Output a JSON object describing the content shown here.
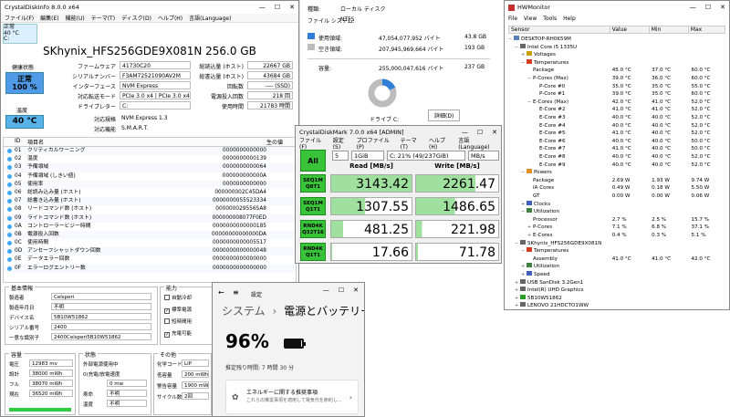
{
  "cdi": {
    "title": "CrystalDiskInfo 8.0.0 x64",
    "menu": [
      "ファイル(F)",
      "編集(E)",
      "機能(U)",
      "テーマ(T)",
      "ディスク(D)",
      "ヘルプ(H)",
      "言語(Language)"
    ],
    "mini_status": "正常",
    "mini_temp": "40 °C",
    "mini_drive": "C:",
    "disk_title": "SKhynix_HFS256GDE9X081N 256.0 GB",
    "health_label": "健康状態",
    "health_status": "正常",
    "health_pct": "100 %",
    "temp_label": "温度",
    "temp": "40 °C",
    "info": [
      {
        "l": "ファームウェア",
        "v": "41730C20"
      },
      {
        "l": "シリアルナンバー",
        "v": "F3AM72521090AV2M"
      },
      {
        "l": "インターフェース",
        "v": "NVM Express"
      },
      {
        "l": "対応転送モード",
        "v": "PCIe 3.0 x4 | PCIe 3.0 x4"
      },
      {
        "l": "ドライブレター",
        "v": "C:"
      }
    ],
    "info_r": [
      {
        "l": "総読込量 (ホスト)",
        "v": "22667 GB"
      },
      {
        "l": "総書込量 (ホスト)",
        "v": "43684 GB"
      },
      {
        "l": "回転数",
        "v": "---- (SSD)"
      },
      {
        "l": "電源投入回数",
        "v": "218 回"
      },
      {
        "l": "使用時間",
        "v": "21783 時間"
      }
    ],
    "std_l": "対応規格",
    "std_v": "NVM Express 1.3",
    "feat_l": "対応機能",
    "feat_v": "S.M.A.R.T.",
    "smart_hd": {
      "id": "ID",
      "name": "項目名",
      "raw": "生の値"
    },
    "smart": [
      {
        "id": "01",
        "n": "クリティカルワーニング",
        "r": "0000000000000"
      },
      {
        "id": "02",
        "n": "温度",
        "r": "0000000000139"
      },
      {
        "id": "03",
        "n": "予備領域",
        "r": "0000000000064"
      },
      {
        "id": "04",
        "n": "予備領域 (しきい値)",
        "r": "000000000000A"
      },
      {
        "id": "05",
        "n": "使用率",
        "r": "0000000000000"
      },
      {
        "id": "06",
        "n": "総読み込み量 (ホスト)",
        "r": "000000002C45DA4"
      },
      {
        "id": "07",
        "n": "総書き込み量 (ホスト)",
        "r": "0000000055523334"
      },
      {
        "id": "08",
        "n": "リードコマンド数 (ホスト)",
        "r": "000000029556SA8"
      },
      {
        "id": "09",
        "n": "ライトコマンド数 (ホスト)",
        "r": "000000008077F0ED"
      },
      {
        "id": "0A",
        "n": "コントローラービジー時間",
        "r": "0000000000000185"
      },
      {
        "id": "0B",
        "n": "電源投入回数",
        "r": "00000000000000DA"
      },
      {
        "id": "0C",
        "n": "使用時間",
        "r": "0000000000005517"
      },
      {
        "id": "0D",
        "n": "アンセーフシャットダウン回数",
        "r": "0000000000000048"
      },
      {
        "id": "0E",
        "n": "データエラー回数",
        "r": "0000000000000000"
      },
      {
        "id": "0F",
        "n": "エラーログエントリー数",
        "r": "0000000000000000"
      }
    ],
    "basic": {
      "title": "基本情報",
      "rows": [
        {
          "l": "製造者",
          "v": "Celsperi"
        },
        {
          "l": "製造年月日",
          "v": "不明"
        },
        {
          "l": "デバイス名",
          "v": "5B10W51862"
        },
        {
          "l": "シリアル番号",
          "v": "2400"
        },
        {
          "l": "一意な識別子",
          "v": "2400Celsperi5B10W51862"
        }
      ]
    },
    "ability": {
      "title": "能力",
      "items": [
        {
          "l": "自動冷却",
          "c": false
        },
        {
          "l": "標準電源",
          "c": true
        },
        {
          "l": "短時間用",
          "c": false
        },
        {
          "l": "充電可能",
          "c": true
        }
      ]
    },
    "cap": {
      "title": "容量",
      "rows": [
        {
          "l": "電圧",
          "v": "12983 mv"
        },
        {
          "l": "設計",
          "v": "38000 mWh"
        },
        {
          "l": "フル",
          "v": "38070 mWh"
        },
        {
          "l": "現在",
          "v": "36520 mWh"
        }
      ]
    },
    "state": {
      "title": "状態",
      "rows": [
        {
          "l": "外部電源使用中",
          "v": ""
        },
        {
          "l": "0(充電/放電速度",
          "v": ""
        },
        {
          "l": "",
          "v": "0 mw"
        },
        {
          "l": "寿命",
          "v": "不明"
        },
        {
          "l": "温度",
          "v": "不明"
        }
      ]
    },
    "other": {
      "title": "その他",
      "rows": [
        {
          "l": "化学コード",
          "v": "LiP"
        },
        {
          "l": "低容量",
          "v": "200 mWh"
        },
        {
          "l": "警告容量",
          "v": "1900 mWh"
        },
        {
          "l": "サイクル数",
          "v": "2回"
        }
      ]
    }
  },
  "fp": {
    "type_l": "種類:",
    "type_v": "ローカル ディスク",
    "fs_l": "ファイル システム:",
    "fs_v": "NTFS",
    "used_l": "使用領域:",
    "used_b": "47,054,077,952 バイト",
    "used_g": "43.8 GB",
    "free_l": "空き領域:",
    "free_b": "207,945,969,664 バイト",
    "free_g": "193 GB",
    "cap_l": "容量:",
    "cap_b": "255,000,047,616 バイト",
    "cap_g": "237 GB",
    "drive": "ドライブ C:",
    "detail": "詳細(D)",
    "used_color": "#2f7fd8",
    "free_color": "#bcbcbc"
  },
  "cdm": {
    "title": "CrystalDiskMark 7.0.0 x64 [ADMIN]",
    "menu": [
      "ファイル(F)",
      "設定(S)",
      "プロファイル(P)",
      "テーマ(T)",
      "ヘルプ(H)",
      "言語(Language)"
    ],
    "count": "5",
    "size": "1GiB",
    "drive": "C: 21% (49/237GiB)",
    "unit": "MB/s",
    "all": "All",
    "read_hd": "Read [MB/s]",
    "write_hd": "Write [MB/s]",
    "rows": [
      {
        "b1": "SEQ1M",
        "b2": "Q8T1",
        "r": "3143.42",
        "w": "2261.47",
        "rf": 1.0,
        "wf": 0.72
      },
      {
        "b1": "SEQ1M",
        "b2": "Q1T1",
        "r": "1307.55",
        "w": "1486.65",
        "rf": 0.42,
        "wf": 0.47
      },
      {
        "b1": "RND4K",
        "b2": "Q32T16",
        "r": "481.25",
        "w": "221.98",
        "rf": 0.15,
        "wf": 0.07
      },
      {
        "b1": "RND4K",
        "b2": "Q1T1",
        "r": "17.66",
        "w": "71.78",
        "rf": 0.01,
        "wf": 0.02
      }
    ]
  },
  "settings": {
    "back": "←",
    "menu": "≡",
    "title": "設定",
    "crumb1": "システム",
    "sep": "›",
    "crumb2": "電源とバッテリー",
    "pct": "96%",
    "battery_level": 0.96,
    "remain": "推定残り時間: 7 時間 30 分",
    "card_t": "エネルギーに関する推奨事項",
    "card_s": "これらの推奨事項を適用して電気代を節約し..."
  },
  "hwm": {
    "title": "HWMonitor",
    "menu": [
      "File",
      "View",
      "Tools",
      "Help"
    ],
    "cols": [
      "Sensor",
      "Value",
      "Min",
      "Max"
    ],
    "rows": [
      {
        "d": 0,
        "t": "−",
        "n": "DESKTOP-RH0K59M",
        "v": "",
        "mn": "",
        "mx": "",
        "ic": "#5a7fbf"
      },
      {
        "d": 1,
        "t": "−",
        "n": "Intel Core i5 1335U",
        "v": "",
        "mn": "",
        "mx": "",
        "ic": "#666"
      },
      {
        "d": 2,
        "t": "+",
        "n": "Voltages",
        "v": "",
        "mn": "",
        "mx": "",
        "ic": "#c8a000"
      },
      {
        "d": 2,
        "t": "−",
        "n": "Temperatures",
        "v": "",
        "mn": "",
        "mx": "",
        "ic": "#d04020"
      },
      {
        "d": 3,
        "t": "",
        "n": "Package",
        "v": "45.0 °C",
        "mn": "37.0 °C",
        "mx": "60.0 °C"
      },
      {
        "d": 3,
        "t": "−",
        "n": "P-Cores (Max)",
        "v": "39.0 °C",
        "mn": "36.0 °C",
        "mx": "60.0 °C"
      },
      {
        "d": 4,
        "t": "",
        "n": "P-Core #0",
        "v": "35.0 °C",
        "mn": "35.0 °C",
        "mx": "55.0 °C"
      },
      {
        "d": 4,
        "t": "",
        "n": "P-Core #1",
        "v": "39.0 °C",
        "mn": "35.0 °C",
        "mx": "60.0 °C"
      },
      {
        "d": 3,
        "t": "−",
        "n": "E-Cores (Max)",
        "v": "42.0 °C",
        "mn": "41.0 °C",
        "mx": "52.0 °C"
      },
      {
        "d": 4,
        "t": "",
        "n": "E-Core #2",
        "v": "41.0 °C",
        "mn": "41.0 °C",
        "mx": "52.0 °C"
      },
      {
        "d": 4,
        "t": "",
        "n": "E-Core #3",
        "v": "40.0 °C",
        "mn": "40.0 °C",
        "mx": "52.0 °C"
      },
      {
        "d": 4,
        "t": "",
        "n": "E-Core #4",
        "v": "40.0 °C",
        "mn": "40.0 °C",
        "mx": "52.0 °C"
      },
      {
        "d": 4,
        "t": "",
        "n": "E-Core #5",
        "v": "41.0 °C",
        "mn": "40.0 °C",
        "mx": "52.0 °C"
      },
      {
        "d": 4,
        "t": "",
        "n": "E-Core #6",
        "v": "40.0 °C",
        "mn": "40.0 °C",
        "mx": "50.0 °C"
      },
      {
        "d": 4,
        "t": "",
        "n": "E-Core #7",
        "v": "41.0 °C",
        "mn": "40.0 °C",
        "mx": "50.0 °C"
      },
      {
        "d": 4,
        "t": "",
        "n": "E-Core #8",
        "v": "40.0 °C",
        "mn": "40.0 °C",
        "mx": "52.0 °C"
      },
      {
        "d": 4,
        "t": "",
        "n": "E-Core #9",
        "v": "40.0 °C",
        "mn": "40.0 °C",
        "mx": "52.0 °C"
      },
      {
        "d": 2,
        "t": "−",
        "n": "Powers",
        "v": "",
        "mn": "",
        "mx": "",
        "ic": "#e09020"
      },
      {
        "d": 3,
        "t": "",
        "n": "Package",
        "v": "2.69 W",
        "mn": "1.93 W",
        "mx": "9.74 W"
      },
      {
        "d": 3,
        "t": "",
        "n": "IA Cores",
        "v": "0.49 W",
        "mn": "0.18 W",
        "mx": "5.50 W"
      },
      {
        "d": 3,
        "t": "",
        "n": "GT",
        "v": "0.00 W",
        "mn": "0.00 W",
        "mx": "0.06 W"
      },
      {
        "d": 2,
        "t": "+",
        "n": "Clocks",
        "v": "",
        "mn": "",
        "mx": "",
        "ic": "#4060c0"
      },
      {
        "d": 2,
        "t": "−",
        "n": "Utilization",
        "v": "",
        "mn": "",
        "mx": "",
        "ic": "#408040"
      },
      {
        "d": 3,
        "t": "",
        "n": "Processor",
        "v": "2.7 %",
        "mn": "2.5 %",
        "mx": "15.7 %"
      },
      {
        "d": 3,
        "t": "+",
        "n": "P-Cores",
        "v": "7.1 %",
        "mn": "6.8 %",
        "mx": "37.1 %"
      },
      {
        "d": 3,
        "t": "+",
        "n": "E-Cores",
        "v": "0.4 %",
        "mn": "0.3 %",
        "mx": "5.1 %"
      },
      {
        "d": 1,
        "t": "−",
        "n": "SKhynix_HFS256GDE9X081N",
        "v": "",
        "mn": "",
        "mx": "",
        "ic": "#666"
      },
      {
        "d": 2,
        "t": "−",
        "n": "Temperatures",
        "v": "",
        "mn": "",
        "mx": "",
        "ic": "#d04020"
      },
      {
        "d": 3,
        "t": "",
        "n": "Assembly",
        "v": "41.0 °C",
        "mn": "41.0 °C",
        "mx": "42.0 °C"
      },
      {
        "d": 2,
        "t": "+",
        "n": "Utilization",
        "v": "",
        "mn": "",
        "mx": "",
        "ic": "#408040"
      },
      {
        "d": 2,
        "t": "+",
        "n": "Speed",
        "v": "",
        "mn": "",
        "mx": "",
        "ic": "#4060c0"
      },
      {
        "d": 1,
        "t": "+",
        "n": "USB  SanDisk 3.2Gen1",
        "v": "",
        "mn": "",
        "mx": "",
        "ic": "#666"
      },
      {
        "d": 1,
        "t": "+",
        "n": "Intel(R) UHD Graphics",
        "v": "",
        "mn": "",
        "mx": "",
        "ic": "#666"
      },
      {
        "d": 1,
        "t": "+",
        "n": "5B10W51862",
        "v": "",
        "mn": "",
        "mx": "",
        "ic": "#2a9d2a"
      },
      {
        "d": 1,
        "t": "+",
        "n": "LENOVO 21HDCTO1WW",
        "v": "",
        "mn": "",
        "mx": "",
        "ic": "#666"
      }
    ]
  }
}
